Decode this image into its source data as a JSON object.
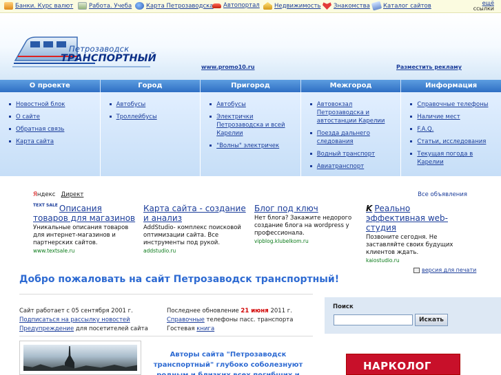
{
  "topbar": {
    "links": [
      {
        "label": "Банки. Курс валют",
        "icon": "chart-icon"
      },
      {
        "label": "Работа. Учеба",
        "icon": "work-icon"
      },
      {
        "label": "Карта Петрозаводска",
        "icon": "map-icon"
      },
      {
        "label": "Автопортал",
        "icon": "car-icon"
      },
      {
        "label": "Недвижимость",
        "icon": "house-icon"
      },
      {
        "label": "Знакомства",
        "icon": "heart-icon"
      },
      {
        "label": "Каталог сайтов",
        "icon": "catalog-icon"
      }
    ],
    "more_label": "ещё",
    "more_sub": "ссылки"
  },
  "header": {
    "logo_line1": "Петрозаводск",
    "logo_line2": "ТРАНСПОРТНЫЙ",
    "promo_link": "www.promo10.ru",
    "advert_link": "Разместить рекламу"
  },
  "nav": {
    "tabs": [
      "О проекте",
      "Город",
      "Пригород",
      "Межгород",
      "Информация"
    ]
  },
  "submenu": {
    "col1": [
      "Новостной блок",
      "О сайте",
      "Обратная связь",
      "Карта сайта"
    ],
    "col2": [
      "Автобусы",
      "Троллейбусы"
    ],
    "col3": [
      "Автобусы",
      "Электрички Петрозаводска и всей Карелии",
      "\"Волны\" электричек"
    ],
    "col4": [
      "Автовокзал Петрозаводска и автостанции Карелии",
      "Поезда дальнего следования",
      "Водный транспорт",
      "Авиатранспорт"
    ],
    "col5": [
      "Справочные телефоны",
      "Наличие мест",
      "F.A.Q.",
      "Статьи, исследования",
      "Текущая погода в Карелии"
    ]
  },
  "yandex": {
    "brand_y": "Я",
    "brand_rest": "ндекс",
    "direct": "Директ",
    "all_ads": "Все объявления",
    "ads": [
      {
        "badge": "TEXT SALE",
        "title": "Описания товаров для магазинов",
        "desc": "Уникальные описания товаров для интернет-магазинов и партнерских сайтов.",
        "url": "www.textsale.ru"
      },
      {
        "title": "Карта сайта - создание и анализ",
        "desc": "AddStudio- комплекс поисковой оптимизации сайта. Все инструменты под рукой.",
        "url": "addstudio.ru"
      },
      {
        "title": "Блог под ключ",
        "desc": "Нет блога? Закажите недорого создание блога на wordpress у профессионала.",
        "url": "vipblog.klubelkom.ru"
      },
      {
        "badge": "K",
        "title": "Реально эффективная web-студия",
        "desc": "Позвоните сегодня. Не заставляйте своих будущих клиентов ждать.",
        "url": "kaiostudio.ru"
      }
    ]
  },
  "print_version": "версия для печати",
  "welcome": "Добро пожаловать на сайт Петрозаводск транспортный!",
  "info": {
    "since": "Сайт работает с 05 сентября 2001 г.",
    "subscribe": "Подписаться на рассылку новостей",
    "warning_link": "Предупреждение",
    "warning_rest": " для посетителей сайта",
    "updated_prefix": "Последнее обновление ",
    "updated_date": "21 июня",
    "updated_suffix": " 2011 г.",
    "phones_link": "Справочные",
    "phones_rest": " телефоны  пасс. транспорта",
    "guestbook_prefix": "Гостевая ",
    "guestbook_link": "книга"
  },
  "condolence": "Авторы сайта \"Петрозаводск транспортный\" глубоко соболезнуют родным и близких всех погибших и пострадавших в ужасной",
  "search": {
    "label": "Поиск",
    "value": "",
    "button": "Искать"
  },
  "banner": "НАРКОЛОГ",
  "colors": {
    "nav": "#2f6fc4",
    "link": "#1a3c9a",
    "heading": "#2d6ad2",
    "highlight": "#d10000"
  }
}
